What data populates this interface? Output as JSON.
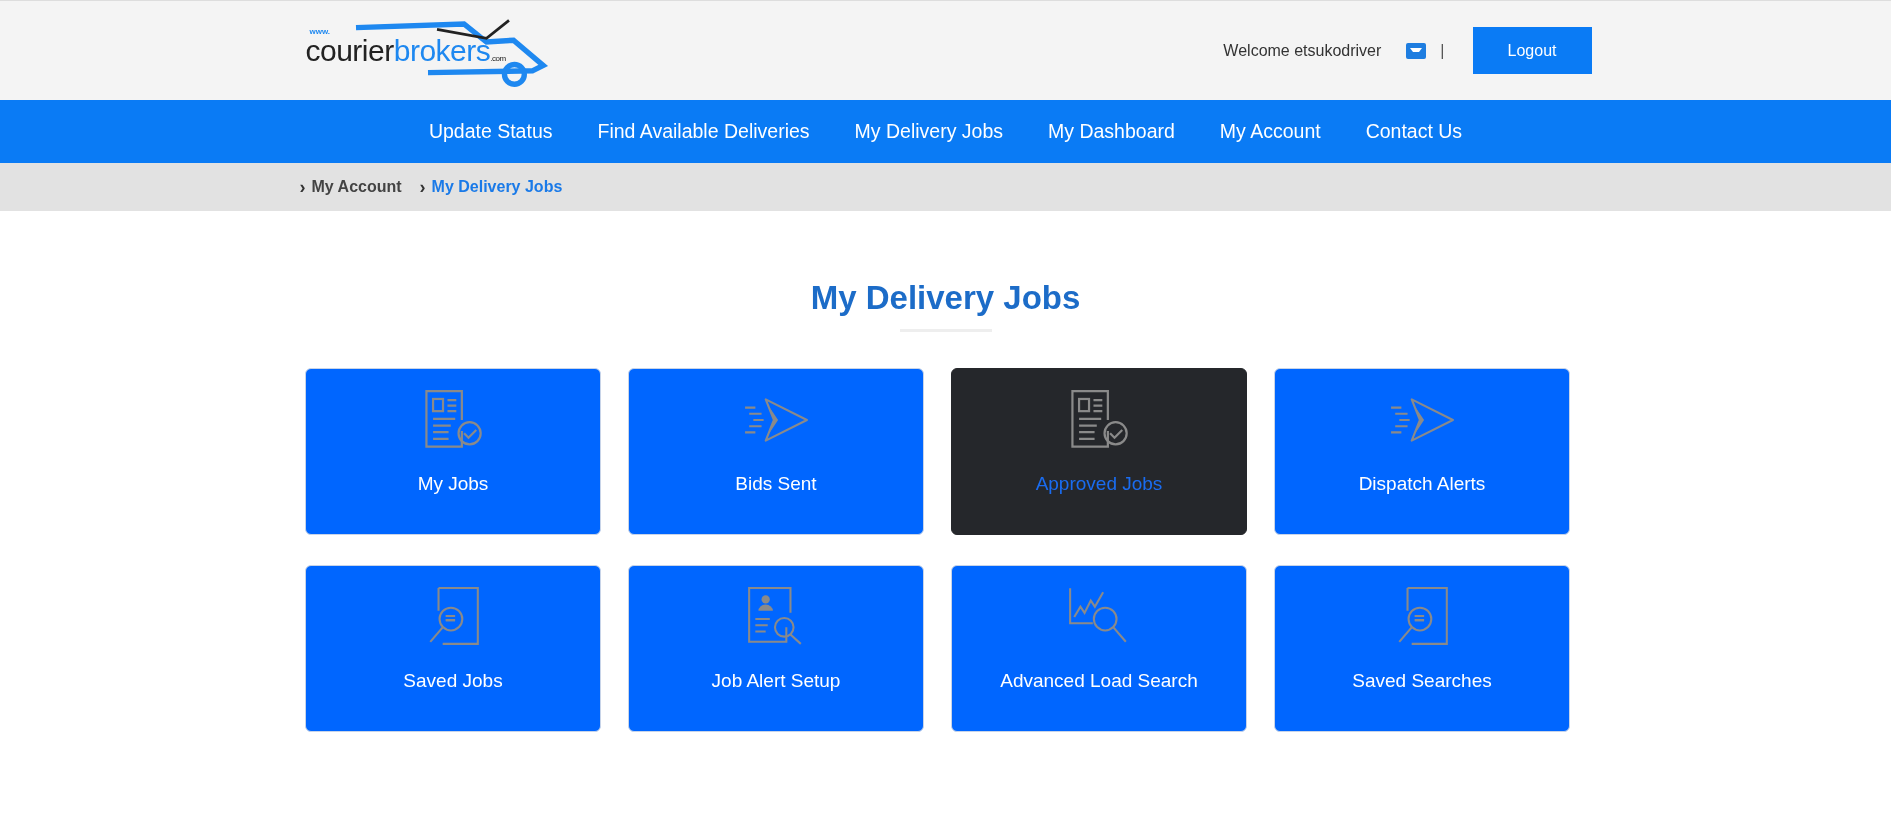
{
  "logo": {
    "prefix": "www.",
    "word_1": "courier",
    "word_2": "brokers",
    "suffix": ".com"
  },
  "header": {
    "welcome": "Welcome etsukodriver",
    "separator": "|",
    "logout": "Logout"
  },
  "nav": [
    {
      "label": "Update Status"
    },
    {
      "label": "Find Available Deliveries"
    },
    {
      "label": "My Delivery Jobs"
    },
    {
      "label": "My Dashboard"
    },
    {
      "label": "My Account"
    },
    {
      "label": "Contact Us"
    }
  ],
  "breadcrumb": [
    {
      "chevron": "›",
      "label": "My Account",
      "selected": false
    },
    {
      "chevron": "›",
      "label": "My Delivery Jobs",
      "selected": true
    }
  ],
  "page_title": "My Delivery Jobs",
  "tiles": [
    {
      "label": "My Jobs",
      "kind": "doc-check",
      "selected": false
    },
    {
      "label": "Bids Sent",
      "kind": "plane",
      "selected": false
    },
    {
      "label": "Approved Jobs",
      "kind": "doc-check",
      "selected": true
    },
    {
      "label": "Dispatch Alerts",
      "kind": "plane",
      "selected": false
    },
    {
      "label": "Saved Jobs",
      "kind": "doc-search",
      "selected": false
    },
    {
      "label": "Job Alert Setup",
      "kind": "profile-search",
      "selected": false
    },
    {
      "label": "Advanced Load Search",
      "kind": "chart-search",
      "selected": false
    },
    {
      "label": "Saved Searches",
      "kind": "doc-search",
      "selected": false
    }
  ]
}
